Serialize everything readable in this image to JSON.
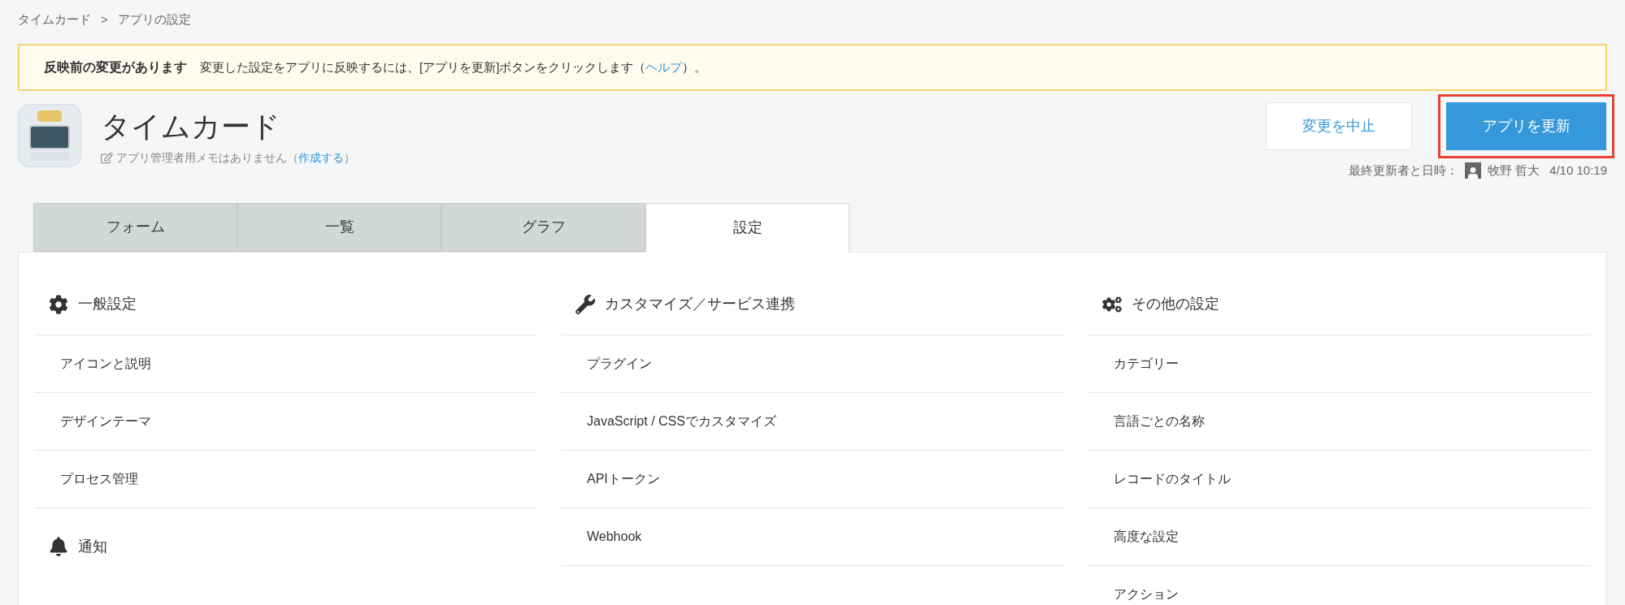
{
  "breadcrumb": {
    "items": [
      "タイムカード",
      "アプリの設定"
    ],
    "separator": ">"
  },
  "notice": {
    "title": "反映前の変更があります",
    "message": "変更した設定をアプリに反映するには、[アプリを更新]ボタンをクリックします（",
    "link": "ヘルプ",
    "suffix": "）。"
  },
  "app": {
    "title": "タイムカード",
    "memo": "アプリ管理者用メモはありません（",
    "memo_link": "作成する",
    "memo_suffix": "）"
  },
  "buttons": [
    {
      "label": "変更を中止",
      "kind": "secondary",
      "highlighted": false
    },
    {
      "label": "アプリを更新",
      "kind": "primary",
      "highlighted": true
    }
  ],
  "last_updated": {
    "label": "最終更新者と日時：",
    "user": "牧野 哲大",
    "time": "4/10 10:19"
  },
  "tabs": [
    {
      "label": "フォーム",
      "selected": false
    },
    {
      "label": "一覧",
      "selected": false
    },
    {
      "label": "グラフ",
      "selected": false
    },
    {
      "label": "設定",
      "selected": true
    }
  ],
  "sections": [
    {
      "title": "一般設定",
      "items": [
        "アイコンと説明",
        "デザインテーマ",
        "プロセス管理"
      ]
    },
    {
      "title": "通知"
    },
    {
      "title": "カスタマイズ／サービス連携",
      "items": [
        "プラグイン",
        "JavaScript / CSSでカスタマイズ",
        "APIトークン",
        "Webhook"
      ]
    },
    {
      "title": "その他の設定",
      "items": [
        "カテゴリー",
        "言語ごとの名称",
        "レコードのタイトル",
        "高度な設定",
        "アクション"
      ]
    }
  ]
}
